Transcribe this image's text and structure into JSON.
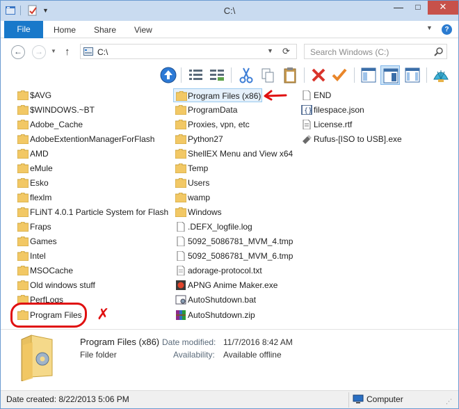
{
  "window": {
    "title": "C:\\",
    "controls": {
      "minimize": "—",
      "maximize": "□",
      "close": "✕"
    }
  },
  "ribbon": {
    "tabs": [
      {
        "label": "File",
        "active": true
      },
      {
        "label": "Home"
      },
      {
        "label": "Share"
      },
      {
        "label": "View"
      }
    ],
    "help": "?"
  },
  "navigation": {
    "back": "←",
    "forward": "→",
    "up": "↑",
    "address": "C:\\",
    "search_placeholder": "Search Windows (C:)"
  },
  "toolbar": {
    "buttons": [
      {
        "icon": "up-folder-icon"
      },
      {
        "icon": "details-view-icon"
      },
      {
        "icon": "list-view-icon"
      },
      {
        "icon": "cut-icon"
      },
      {
        "icon": "copy-icon"
      },
      {
        "icon": "paste-icon"
      },
      {
        "icon": "delete-icon"
      },
      {
        "icon": "check-icon"
      },
      {
        "icon": "preview-pane-icon"
      },
      {
        "icon": "details-pane-icon",
        "active": true
      },
      {
        "icon": "navigation-pane-icon"
      },
      {
        "icon": "shell-icon"
      }
    ]
  },
  "files": {
    "column1": [
      {
        "name": "$AVG",
        "type": "folder"
      },
      {
        "name": "$WINDOWS.~BT",
        "type": "folder"
      },
      {
        "name": "Adobe_Cache",
        "type": "folder"
      },
      {
        "name": "AdobeExtentionManagerForFlash",
        "type": "folder"
      },
      {
        "name": "AMD",
        "type": "folder"
      },
      {
        "name": "eMule",
        "type": "folder"
      },
      {
        "name": "Esko",
        "type": "folder"
      },
      {
        "name": "flexlm",
        "type": "folder"
      },
      {
        "name": "FLiNT 4.0.1 Particle System for Flash",
        "type": "folder"
      },
      {
        "name": "Fraps",
        "type": "folder"
      },
      {
        "name": "Games",
        "type": "folder"
      },
      {
        "name": "Intel",
        "type": "folder"
      },
      {
        "name": "MSOCache",
        "type": "folder"
      },
      {
        "name": "Old windows stuff",
        "type": "folder"
      },
      {
        "name": "PerfLogs",
        "type": "folder"
      },
      {
        "name": "Program Files",
        "type": "folder"
      }
    ],
    "column2": [
      {
        "name": "Program Files (x86)",
        "type": "folder",
        "selected": true
      },
      {
        "name": "ProgramData",
        "type": "folder"
      },
      {
        "name": "Proxies, vpn, etc",
        "type": "folder"
      },
      {
        "name": "Python27",
        "type": "folder"
      },
      {
        "name": "ShellEX Menu and View x64",
        "type": "folder"
      },
      {
        "name": "Temp",
        "type": "folder"
      },
      {
        "name": "Users",
        "type": "folder"
      },
      {
        "name": "wamp",
        "type": "folder"
      },
      {
        "name": "Windows",
        "type": "folder"
      },
      {
        "name": ".DEFX_logfile.log",
        "type": "file"
      },
      {
        "name": "5092_5086781_MVM_4.tmp",
        "type": "file"
      },
      {
        "name": "5092_5086781_MVM_6.tmp",
        "type": "file"
      },
      {
        "name": "adorage-protocol.txt",
        "type": "file"
      },
      {
        "name": "APNG Anime Maker.exe",
        "type": "app"
      },
      {
        "name": "AutoShutdown.bat",
        "type": "bat"
      },
      {
        "name": "AutoShutdown.zip",
        "type": "zip"
      }
    ],
    "column3": [
      {
        "name": "END",
        "type": "file"
      },
      {
        "name": "filespace.json",
        "type": "json"
      },
      {
        "name": "License.rtf",
        "type": "file"
      },
      {
        "name": "Rufus-[ISO to USB].exe",
        "type": "usb"
      }
    ]
  },
  "annotations": {
    "x_mark": "✗"
  },
  "details": {
    "name": "Program Files (x86)",
    "type": "File folder",
    "modified_label": "Date modified:",
    "modified_value": "11/7/2016 8:42 AM",
    "availability_label": "Availability:",
    "availability_value": "Available offline"
  },
  "status": {
    "left": "Date created: 8/22/2013 5:06 PM",
    "right": "Computer"
  },
  "colors": {
    "accent": "#1979ca",
    "folder": "#f2c865",
    "annotation": "#e01010",
    "selection": "#e5f1fb"
  }
}
